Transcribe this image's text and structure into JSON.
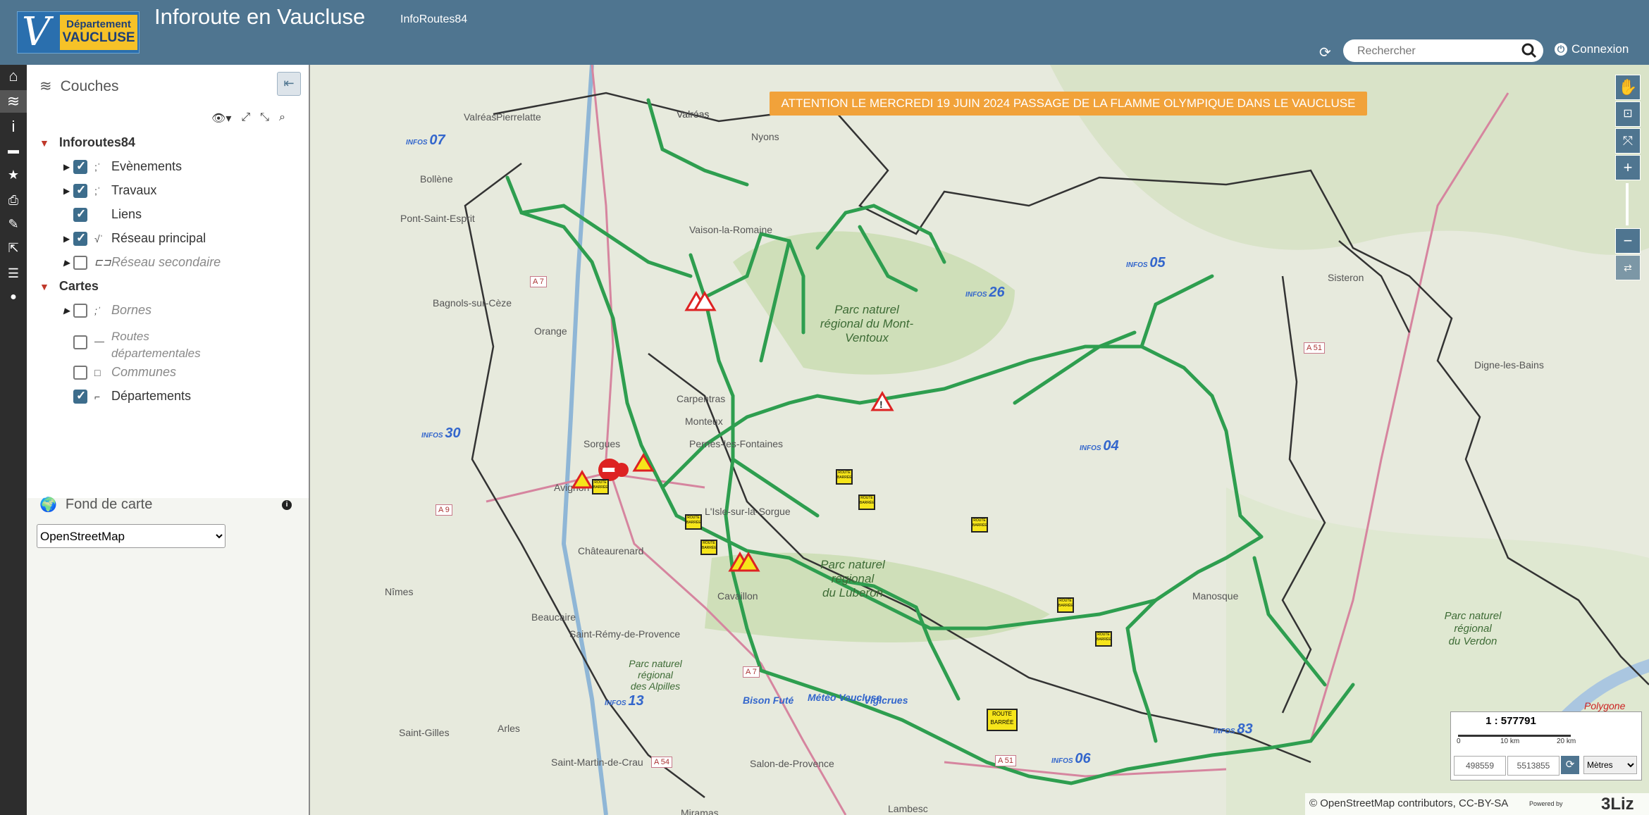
{
  "header": {
    "logo_line1": "Département",
    "logo_line2": "VAUCLUSE",
    "title": "Inforoute en Vaucluse",
    "subtitle": "InfoRoutes84",
    "search_placeholder": "Rechercher",
    "login_label": "Connexion"
  },
  "layers_panel": {
    "title": "Couches",
    "root_group": "Inforoutes84",
    "items": [
      {
        "label": "Evènements",
        "checked": true
      },
      {
        "label": "Travaux",
        "checked": true
      },
      {
        "label": "Liens",
        "checked": true
      },
      {
        "label": "Réseau principal",
        "checked": true
      },
      {
        "label": "Réseau secondaire",
        "checked": false
      }
    ],
    "group2": "Cartes",
    "items2": [
      {
        "label": "Bornes",
        "checked": false
      },
      {
        "label": "Routes",
        "checked": false
      },
      {
        "label2": "départementales"
      },
      {
        "label": "Communes",
        "checked": false
      },
      {
        "label": "Départements",
        "checked": true
      }
    ],
    "basemap_title": "Fond de carte",
    "basemap_value": "OpenStreetMap"
  },
  "map": {
    "banner": "ATTENTION LE MERCREDI 19 JUIN 2024 PASSAGE DE LA FLAMME OLYMPIQUE DANS LE VAUCLUSE",
    "towns": [
      "Valréas",
      "Pierrelatte",
      "Nyons",
      "Bollène",
      "Pont-Saint-Esprit",
      "Vaison-la-Romaine",
      "Bagnols-sur-Cèze",
      "Orange",
      "Carpentras",
      "Monteux",
      "Pernes-les-Fontaines",
      "Sorgues",
      "Avignon",
      "L'Isle-sur-la-Sorgue",
      "Châteaurenard",
      "Cavaillon",
      "Beaucaire",
      "Saint-Rémy-de-Provence",
      "Arles",
      "Saint-Gilles",
      "Saint-Martin-de-Crau",
      "Salon-de-Provence",
      "Miramas",
      "Manosque",
      "Sisteron",
      "Digne-les-Bains",
      "Lambesc",
      "Nîmes"
    ],
    "parcs": [
      {
        "l1": "Parc naturel",
        "l2": "régional du Mont-",
        "l3": "Ventoux"
      },
      {
        "l1": "Parc naturel",
        "l2": "régional",
        "l3": "du Luberon"
      },
      {
        "l1": "Parc naturel",
        "l2": "régional",
        "l3": "des Alpilles"
      },
      {
        "l1": "Parc naturel",
        "l2": "régional",
        "l3": "du Verdon"
      }
    ],
    "infos": [
      "07",
      "26",
      "05",
      "30",
      "04",
      "13",
      "83",
      "06"
    ],
    "roads": [
      "A 7",
      "A 9",
      "A 51",
      "A 54",
      "A 7",
      "A 51"
    ],
    "other_labels": [
      "Bison Futé",
      "Météo Vaucluse",
      "Vigicrues",
      "Polygone"
    ],
    "route_barree": "ROUTE BARRÉE"
  },
  "scale": {
    "ratio": "1 : 577791",
    "tick0": "0",
    "tick1": "10 km",
    "tick2": "20 km",
    "x": "498559",
    "y": "5513855",
    "unit": "Mètres"
  },
  "attribution": {
    "text": "© OpenStreetMap contributors, CC-BY-SA",
    "powered": "Powered by",
    "brand": "3Liz"
  },
  "colors": {
    "header": "#4f7590",
    "banner": "#f1a23a",
    "route": "#2e9e4f"
  }
}
